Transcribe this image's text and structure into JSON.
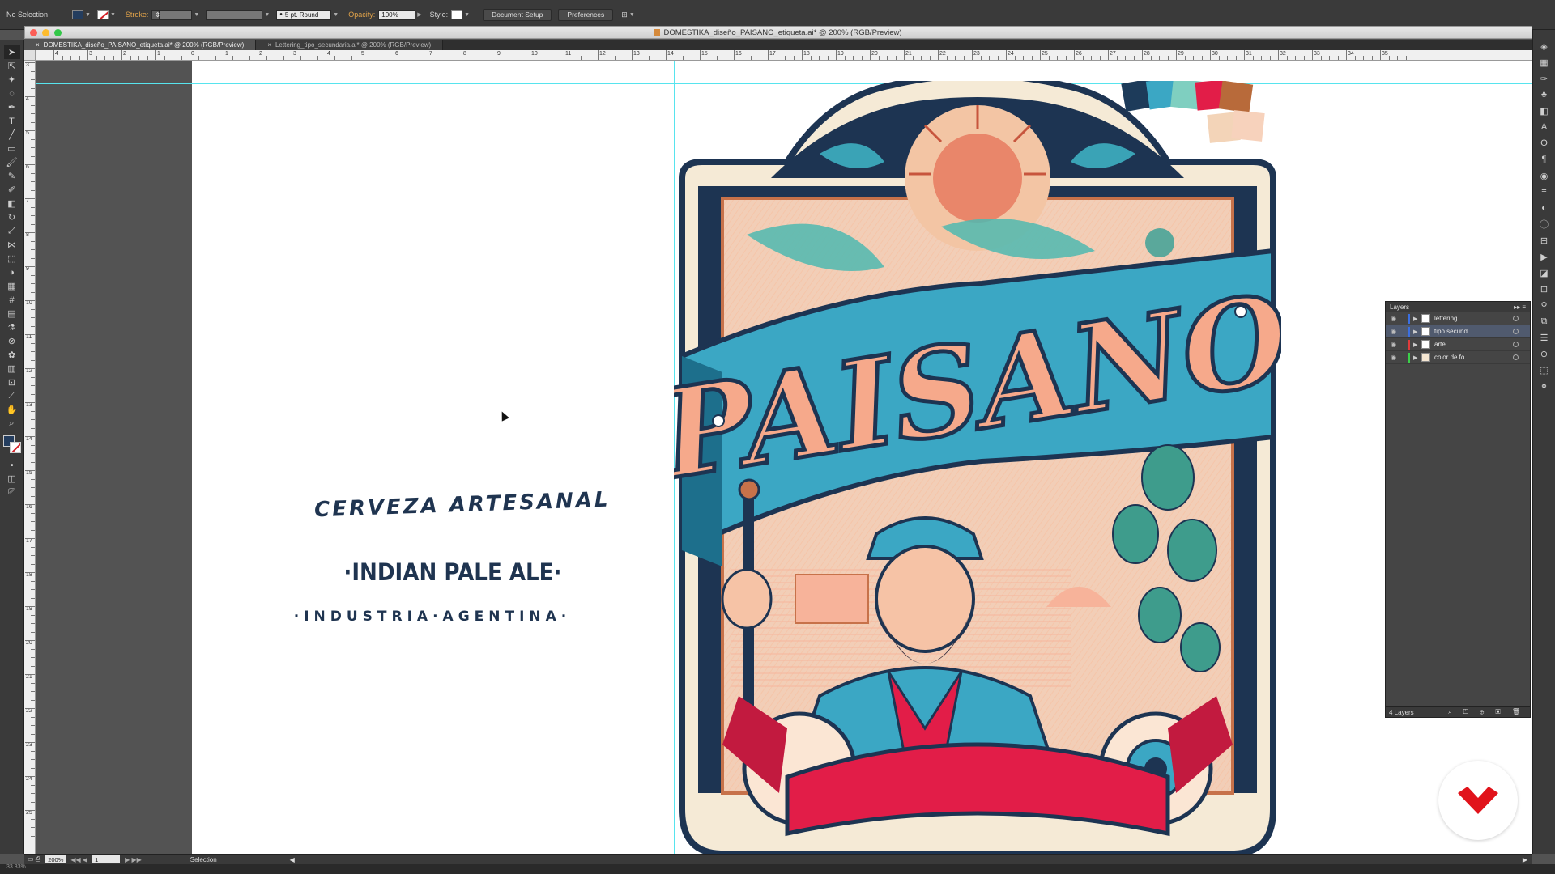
{
  "control_bar": {
    "selection": "No Selection",
    "stroke_label": "Stroke:",
    "brush": "5 pt. Round",
    "opacity_label": "Opacity:",
    "opacity": "100%",
    "style_label": "Style:",
    "document_setup": "Document Setup",
    "preferences": "Preferences"
  },
  "window": {
    "title": "DOMESTIKA_diseño_PAISANO_etiqueta.ai* @ 200% (RGB/Preview)",
    "tabs": [
      {
        "label": "DOMESTIKA_diseño_PAISANO_etiqueta.ai* @ 200% (RGB/Preview)"
      },
      {
        "label": "Lettering_tipo_secundaria.ai* @ 200% (RGB/Preview)"
      }
    ]
  },
  "ruler": {
    "h_labels": [
      "4",
      "3",
      "2",
      "1",
      "0",
      "1",
      "2",
      "3",
      "4",
      "5",
      "6",
      "7",
      "8",
      "9",
      "10",
      "11",
      "12",
      "13",
      "14",
      "15",
      "16",
      "17",
      "18",
      "19",
      "20",
      "21",
      "22",
      "23",
      "24",
      "25",
      "26",
      "27",
      "28",
      "29",
      "30",
      "31",
      "32",
      "33",
      "34",
      "35"
    ],
    "v_labels": [
      "3",
      "4",
      "5",
      "6",
      "7",
      "8",
      "9",
      "10",
      "11",
      "12",
      "13",
      "14",
      "15",
      "16",
      "17",
      "18",
      "19",
      "20",
      "21",
      "22",
      "23",
      "24",
      "25"
    ]
  },
  "artboard_text": {
    "line1": "CERVEZA  ARTESANAL",
    "line2": "·INDIAN PALE ALE·",
    "line3": "·INDUSTRIA·AGENTINA·"
  },
  "label": {
    "brand": "PAISANO",
    "colors": [
      "#1d3b5a",
      "#3ba7c4",
      "#7fcfc0",
      "#e21d48",
      "#b86a3a",
      "#f3d4b8",
      "#f7a787",
      "#1e2f4a"
    ]
  },
  "layers_panel": {
    "title": "Layers",
    "layers": [
      {
        "name": "lettering",
        "color": "#3b6fe0"
      },
      {
        "name": "tipo secund...",
        "color": "#3b6fe0"
      },
      {
        "name": "arte",
        "color": "#e03b3b"
      },
      {
        "name": "color de fo...",
        "color": "#3bd04a"
      }
    ],
    "count": "4 Layers"
  },
  "status_bar": {
    "zoom": "200%",
    "artboard": "1",
    "tool": "Selection"
  },
  "bottom_strip": {
    "zoom": "33.33%"
  }
}
